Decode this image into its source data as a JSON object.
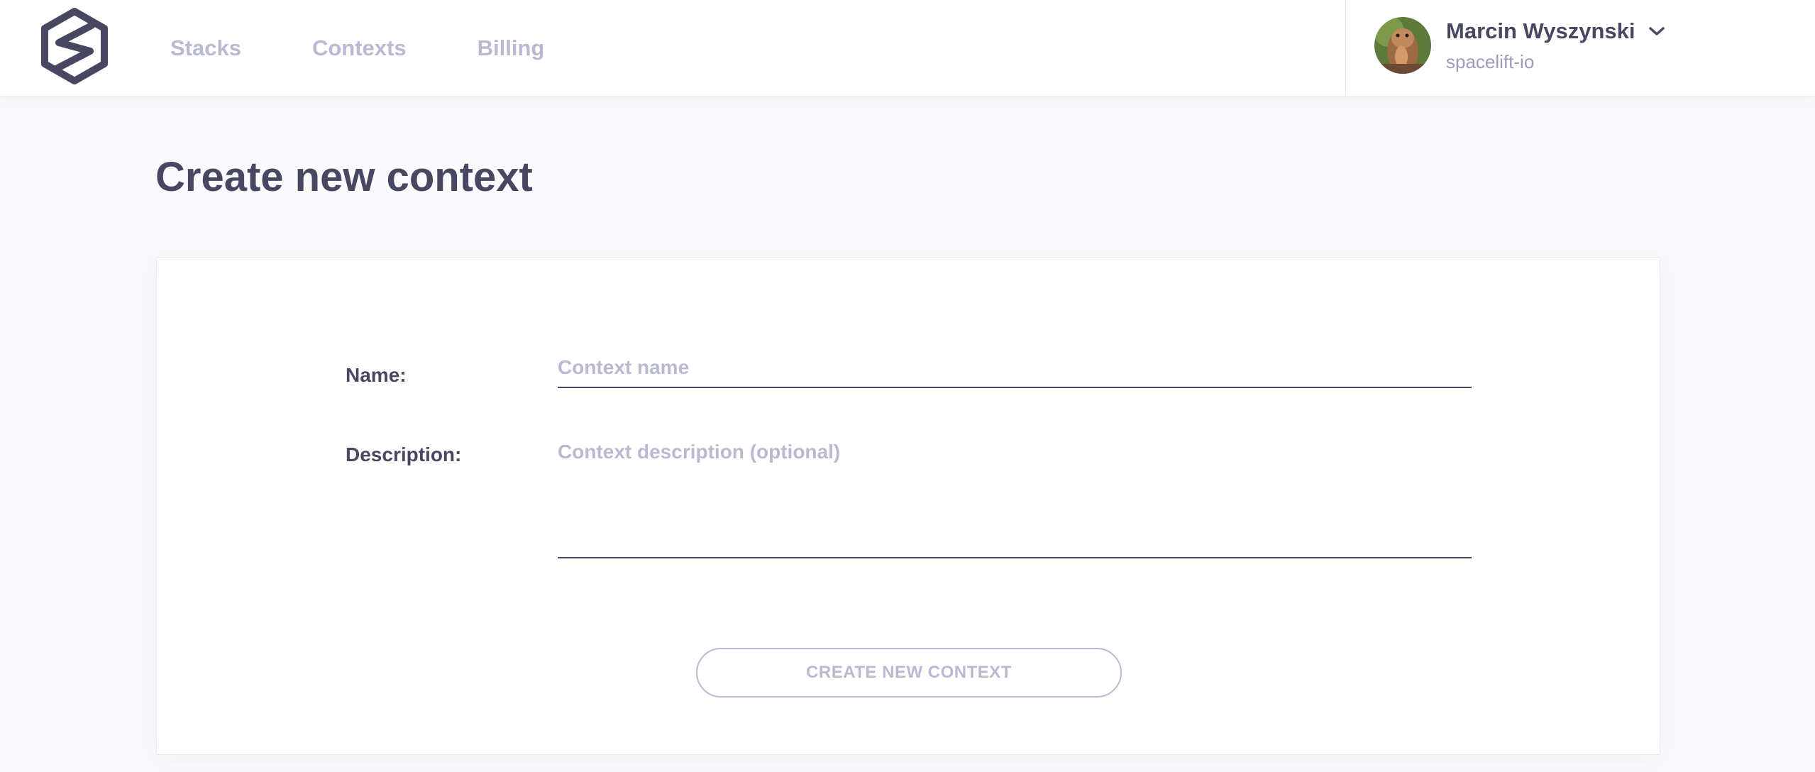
{
  "nav": {
    "items": [
      {
        "label": "Stacks"
      },
      {
        "label": "Contexts"
      },
      {
        "label": "Billing"
      }
    ]
  },
  "user": {
    "name": "Marcin Wyszynski",
    "org": "spacelift-io"
  },
  "page": {
    "title": "Create new context"
  },
  "form": {
    "name_label": "Name:",
    "name_placeholder": "Context name",
    "name_value": "",
    "description_label": "Description:",
    "description_placeholder": "Context description (optional)",
    "description_value": "",
    "submit_label": "CREATE NEW CONTEXT"
  },
  "colors": {
    "text_primary": "#474762",
    "text_muted": "#b9b9d2",
    "background": "#fafafd"
  },
  "icons": {
    "logo": "spacelift-logo",
    "user_menu": "chevron-down-icon"
  }
}
